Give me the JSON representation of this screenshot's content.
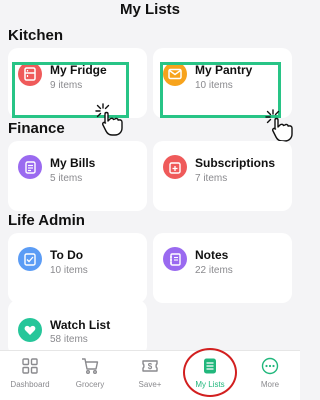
{
  "header": {
    "title": "My Lists"
  },
  "sections": [
    {
      "title": "Kitchen"
    },
    {
      "title": "Finance"
    },
    {
      "title": "Life Admin"
    }
  ],
  "cards": {
    "fridge": {
      "name": "My Fridge",
      "count": "9 items",
      "icon": "fridge-icon",
      "color": "#ef5a5a"
    },
    "pantry": {
      "name": "My Pantry",
      "count": "10 items",
      "icon": "box-icon",
      "color": "#f7a31c"
    },
    "bills": {
      "name": "My Bills",
      "count": "5 items",
      "icon": "document-icon",
      "color": "#9a6af0"
    },
    "subscriptions": {
      "name": "Subscriptions",
      "count": "7 items",
      "icon": "calendar-plus-icon",
      "color": "#ef5a5a"
    },
    "todo": {
      "name": "To Do",
      "count": "10 items",
      "icon": "checklist-icon",
      "color": "#5b9cf5"
    },
    "notes": {
      "name": "Notes",
      "count": "22 items",
      "icon": "notebook-icon",
      "color": "#9a6af0"
    },
    "watchlist": {
      "name": "Watch List",
      "count": "58 items",
      "icon": "heart-icon",
      "color": "#26c69a"
    }
  },
  "tabbar": {
    "items": [
      {
        "label": "Dashboard",
        "icon": "grid-icon"
      },
      {
        "label": "Grocery",
        "icon": "cart-icon"
      },
      {
        "label": "Save+",
        "icon": "dollar-ticket-icon"
      },
      {
        "label": "My Lists",
        "icon": "list-icon",
        "active": true
      },
      {
        "label": "More",
        "icon": "more-icon"
      }
    ]
  },
  "colors": {
    "accent": "#21b77c",
    "highlight": "#28c486",
    "annotation_circle": "#d21f1f"
  }
}
